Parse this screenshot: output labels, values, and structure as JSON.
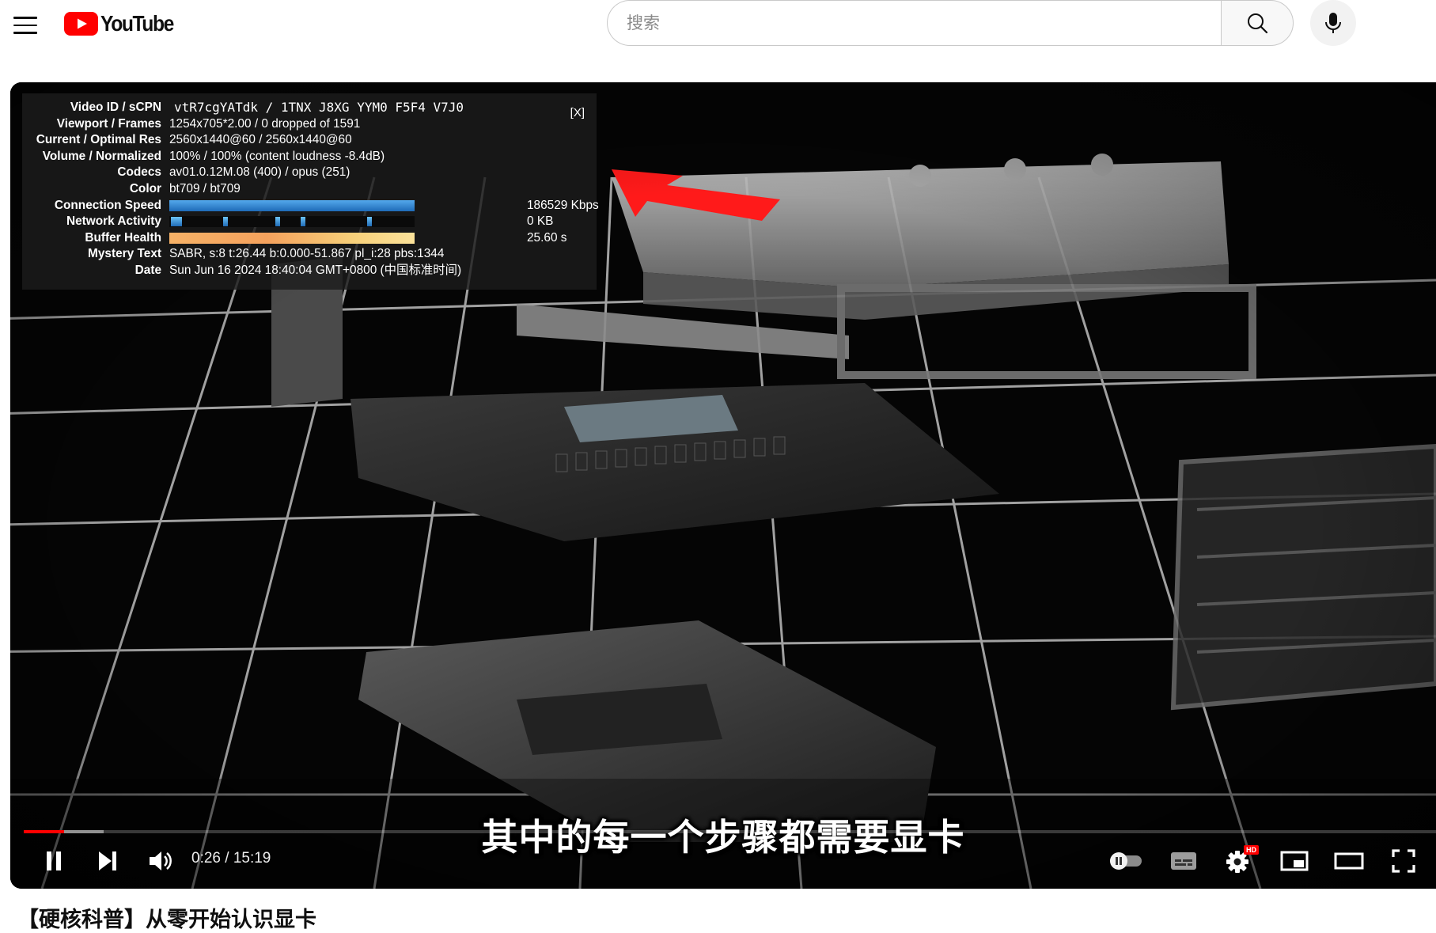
{
  "masthead": {
    "logo_text": "YouTube",
    "search_placeholder": "搜索"
  },
  "stats": {
    "close_label": "[X]",
    "rows": [
      {
        "key": "Video ID / sCPN",
        "value": "vtR7cgYATdk / 1TNX J8XG YYM0 F5F4 V7J0"
      },
      {
        "key": "Viewport / Frames",
        "value": "1254x705*2.00 / 0 dropped of 1591"
      },
      {
        "key": "Current / Optimal Res",
        "value": "2560x1440@60 / 2560x1440@60"
      },
      {
        "key": "Volume / Normalized",
        "value": "100% / 100% (content loudness -8.4dB)"
      },
      {
        "key": "Codecs",
        "value": "av01.0.12M.08 (400) / opus (251)"
      },
      {
        "key": "Color",
        "value": "bt709 / bt709"
      },
      {
        "key": "Connection Speed",
        "value": "186529 Kbps"
      },
      {
        "key": "Network Activity",
        "value": "0 KB"
      },
      {
        "key": "Buffer Health",
        "value": "25.60 s"
      },
      {
        "key": "Mystery Text",
        "value": "SABR, s:8 t:26.44 b:0.000-51.867 pl_i:28 pbs:1344"
      },
      {
        "key": "Date",
        "value": "Sun Jun 16 2024 18:40:04 GMT+0800 (中国标准时间)"
      }
    ]
  },
  "player": {
    "subtitle": "其中的每一个步骤都需要显卡",
    "current_time": "0:26",
    "duration": "15:19",
    "time_display": "0:26 / 15:19",
    "played_fraction": 0.0283,
    "buffered_fraction": 0.0565,
    "quality_badge": "HD",
    "accent_color": "#ff0000"
  },
  "video_title": "【硬核科普】从零开始认识显卡",
  "icons": [
    "menu-icon",
    "youtube-logo",
    "search-icon",
    "mic-icon",
    "pause-icon",
    "next-icon",
    "volume-icon",
    "autoplay-toggle",
    "subtitles-icon",
    "settings-icon",
    "miniplayer-icon",
    "theater-icon",
    "fullscreen-icon"
  ]
}
